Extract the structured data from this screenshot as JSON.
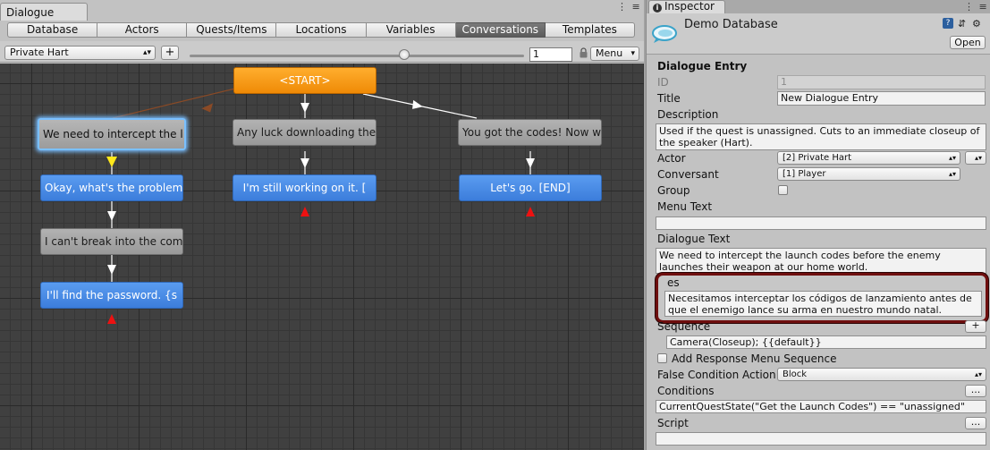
{
  "dialogue": {
    "window_title": "Dialogue",
    "window_tools": "⋮ ≡",
    "tabs": [
      "Database",
      "Actors",
      "Quests/Items",
      "Locations",
      "Variables",
      "Conversations",
      "Templates"
    ],
    "active_tab": "Conversations",
    "conversation_select": "Private Hart",
    "add_button": "+",
    "zoom_value": "1",
    "lock_icon": "lock-icon",
    "menu_label": "Menu",
    "nodes": {
      "start": "<START>",
      "n1": "We need to intercept the l",
      "n2": "Any luck downloading the l",
      "n3": "You got the codes! Now we",
      "n4": "Okay, what's the problem?",
      "n5": "I'm still working on it. [",
      "n6": "Let's go. [END]",
      "n7": "I can't break into the com",
      "n8": "I'll find the password. {s"
    },
    "colors": {
      "npc_node": "#a6a6a6",
      "player_node": "#4a8de6",
      "start_node": "#f69a12",
      "link_active": "#ffffff",
      "link_parent": "#8a4a26",
      "link_selected": "#ffe81a",
      "end_marker": "#ee1111"
    }
  },
  "inspector": {
    "tab_label": "Inspector",
    "database_name": "Demo Database",
    "open_button": "Open",
    "header_icons": [
      "help-icon",
      "settings-icon",
      "gear-icon"
    ],
    "section_title": "Dialogue Entry",
    "id_label": "ID",
    "id_value": "1",
    "title_label": "Title",
    "title_value": "New Dialogue Entry",
    "description_label": "Description",
    "description_value": "Used if the quest is unassigned. Cuts to an immediate closeup of the speaker (Hart).",
    "actor_label": "Actor",
    "actor_value": "[2] Private Hart",
    "conversant_label": "Conversant",
    "conversant_value": "[1] Player",
    "group_label": "Group",
    "group_checked": false,
    "menu_text_label": "Menu Text",
    "menu_text_value": "",
    "dialogue_text_label": "Dialogue Text",
    "dialogue_text_value": "We need to intercept the launch codes before the enemy launches their weapon at our home world.",
    "localized_lang": "es",
    "localized_value": "Necesitamos interceptar los códigos de lanzamiento antes de que el enemigo lance su arma en nuestro mundo natal.",
    "sequence_label": "Sequence",
    "sequence_add": "+",
    "sequence_value": "Camera(Closeup); {{default}}",
    "response_menu_label": "Add Response Menu Sequence",
    "response_menu_checked": false,
    "false_condition_label": "False Condition Action",
    "false_condition_value": "Block",
    "conditions_label": "Conditions",
    "conditions_button": "...",
    "conditions_value": "CurrentQuestState(\"Get the Launch Codes\") == \"unassigned\"",
    "script_label": "Script",
    "script_button": "...",
    "script_value": "",
    "highlight_color": "#6e0e0e"
  }
}
